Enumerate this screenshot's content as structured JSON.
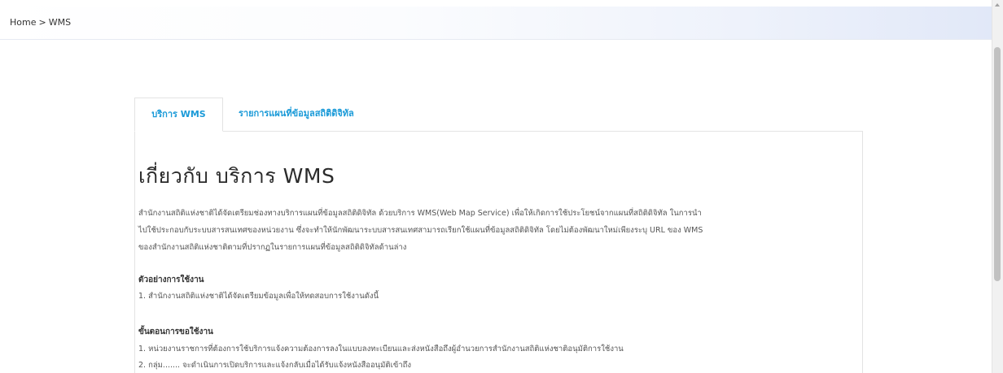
{
  "breadcrumb": {
    "home": "Home",
    "separator": ">",
    "current": "WMS"
  },
  "tabs": [
    {
      "label": "บริการ WMS",
      "active": true
    },
    {
      "label": "รายการแผนที่ข้อมูลสถิติดิจิทัล",
      "active": false
    }
  ],
  "main": {
    "heading": "เกี่ยวกับ บริการ WMS",
    "intro_lines": [
      "สำนักงานสถิติแห่งชาติได้จัดเตรียมช่องทางบริการแผนที่ข้อมูลสถิติดิจิทัล ด้วยบริการ WMS(Web Map Service) เพื่อให้เกิดการใช้ประโยชน์จากแผนที่สถิติดิจิทัล ในการนำ",
      "ไปใช้ประกอบกับระบบสารสนเทศของหน่วยงาน ซึ่งจะทำให้นักพัฒนาระบบสารสนเทศสามารถเรียกใช้แผนที่ข้อมูลสถิติดิจิทัล โดยไม่ต้องพัฒนาใหม่เพียงระบุ URL ของ WMS",
      "ของสำนักงานสถิติแห่งชาติตามที่ปรากฏในรายการแผนที่ข้อมูลสถิติดิจิทัลด้านล่าง"
    ],
    "example_title": "ตัวอย่างการใช้งาน",
    "example_lines": [
      "1. สำนักงานสถิติแห่งชาติได้จัดเตรียมข้อมูลเพื่อให้ทดสอบการใช้งานดังนี้"
    ],
    "steps_title": "ขั้นตอนการขอใช้งาน",
    "steps_lines": [
      "1. หน่วยงานราชการที่ต้องการใช้บริการแจ้งความต้องการลงในแบบลงทะเบียนและส่งหนังสือถึงผู้อำนวยการสำนักงานสถิติแห่งชาติอนุมัติการใช้งาน",
      "2. กลุ่ม....... จะดำเนินการเปิดบริการและแจ้งกลับเมื่อได้รับแจ้งหนังสืออนุมัติเข้าถึง"
    ]
  },
  "colors": {
    "accent": "#1a9ad8",
    "text": "#333333",
    "border": "#e3e3e3"
  }
}
